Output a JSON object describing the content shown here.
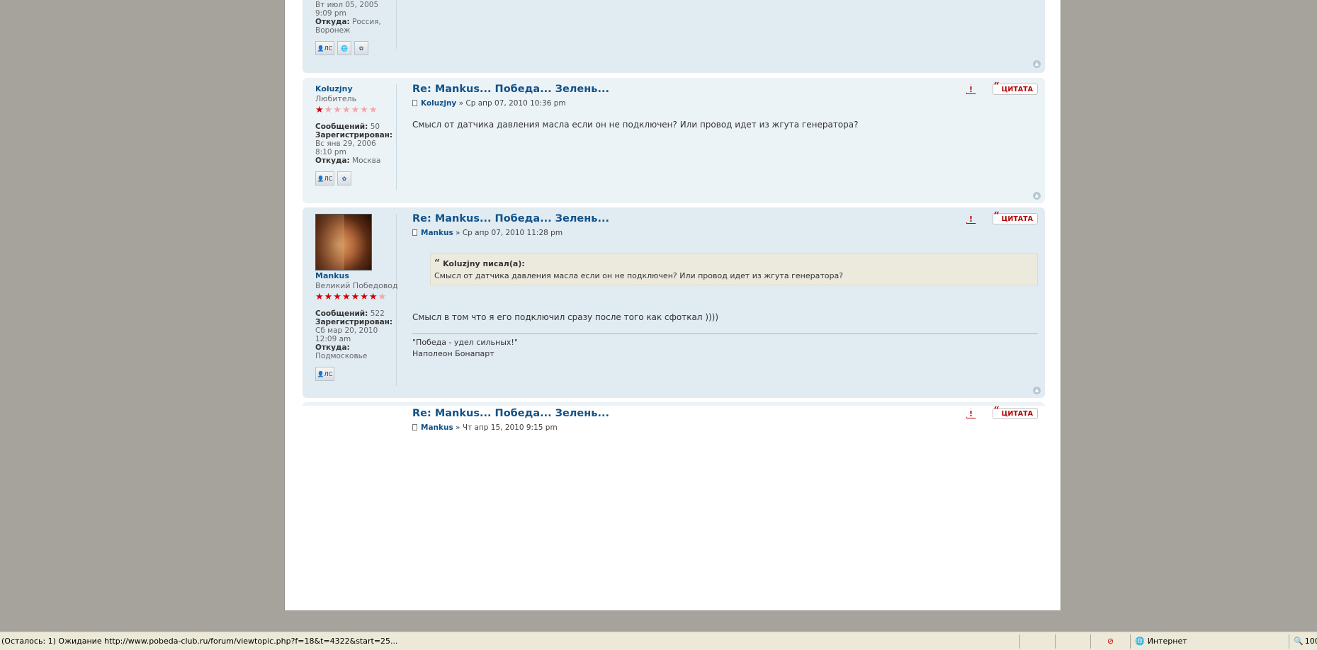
{
  "posts": [
    {
      "partial": true,
      "profile": {
        "joined_date": "Вт июл 05, 2005",
        "joined_time": "9:09 pm",
        "from_label": "Откуда:",
        "from_value_1": "Россия,",
        "from_value_2": "Воронеж"
      },
      "icons": [
        "pm-icon",
        "website-icon",
        "icq-icon"
      ]
    },
    {
      "title": "Re: Mankus... Победа... Зелень...",
      "author": "Koluzjny",
      "date": "Ср апр 07, 2010 10:36 pm",
      "content": "Смысл от датчика давления масла если он не подключен? Или провод идет из жгута генератора?",
      "profile": {
        "name": "Koluzjny",
        "rank": "Любитель",
        "stars_on": 1,
        "stars_total": 7,
        "posts_label": "Сообщений:",
        "posts_value": "50",
        "reg_label": "Зарегистрирован:",
        "reg_date": "Вс янв 29, 2006",
        "reg_time": "8:10 pm",
        "from_label": "Откуда:",
        "from_value": "Москва"
      }
    },
    {
      "title": "Re: Mankus... Победа... Зелень...",
      "author": "Mankus",
      "date": "Ср апр 07, 2010 11:28 pm",
      "quote_author": "Koluzjny писал(а):",
      "quote_text": "Смысл от датчика давления масла если он не подключен? Или провод идет из жгута генератора?",
      "content": "Смысл в том что я его подключил сразу после того как сфоткал ))))",
      "signature_line1": "\"Победа - удел сильных!\"",
      "signature_line2": "Наполеон Бонапарт",
      "profile": {
        "name": "Mankus",
        "rank": "Великий Победовод",
        "stars_on": 7,
        "stars_total": 8,
        "posts_label": "Сообщений:",
        "posts_value": "522",
        "reg_label": "Зарегистрирован:",
        "reg_date": "Сб мар 20, 2010",
        "reg_time": "12:09 am",
        "from_label": "Откуда:",
        "from_value": "Подмосковье"
      }
    },
    {
      "title": "Re: Mankus... Победа... Зелень...",
      "author": "Mankus",
      "date": "Чт апр 15, 2010 9:15 pm"
    }
  ],
  "buttons": {
    "quote_label": "ЦИТАТА",
    "report_label": "!",
    "pm_label": "ЛС"
  },
  "statusbar": {
    "text": "(Осталось: 1) Ожидание http://www.pobeda-club.ru/forum/viewtopic.php?f=18&t=4322&start=25...",
    "zone": "Интернет",
    "zoom": "100"
  }
}
